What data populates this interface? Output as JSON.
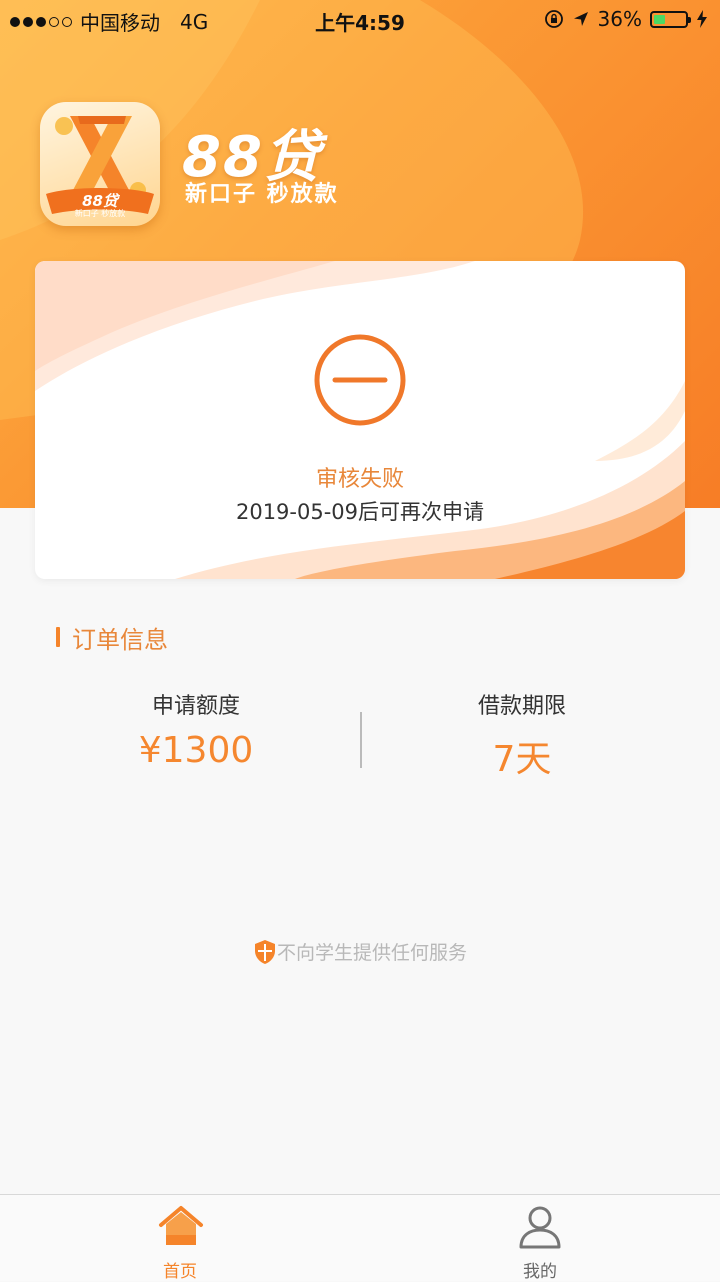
{
  "status_bar": {
    "carrier": "中国移动",
    "network": "4G",
    "time": "上午4:59",
    "battery_percent": "36%",
    "battery_level": 0.36,
    "signal_bars_on": 3,
    "signal_bars_total": 5
  },
  "brand": {
    "name": "88贷",
    "slogan": "新口子 秒放款",
    "logo_badge_text": "88贷",
    "logo_ribbon_text": "新口子 秒放款"
  },
  "application_status": {
    "title": "审核失败",
    "description": "2019-05-09后可再次申请",
    "icon": "minus-circle-icon"
  },
  "order_info": {
    "section_title": "订单信息",
    "amount_label": "申请额度",
    "amount_value": "¥1300",
    "term_label": "借款期限",
    "term_value": "7天"
  },
  "notice": {
    "text": "不向学生提供任何服务",
    "icon": "shield-icon"
  },
  "tab_bar": {
    "items": [
      {
        "label": "首页",
        "icon": "home-icon",
        "active": true
      },
      {
        "label": "我的",
        "icon": "user-icon",
        "active": false
      }
    ]
  },
  "colors": {
    "accent": "#f5842a",
    "hero_start": "#ffb548",
    "hero_end": "#f77d26",
    "text_primary": "#333333",
    "text_muted": "#b8b8b8"
  }
}
